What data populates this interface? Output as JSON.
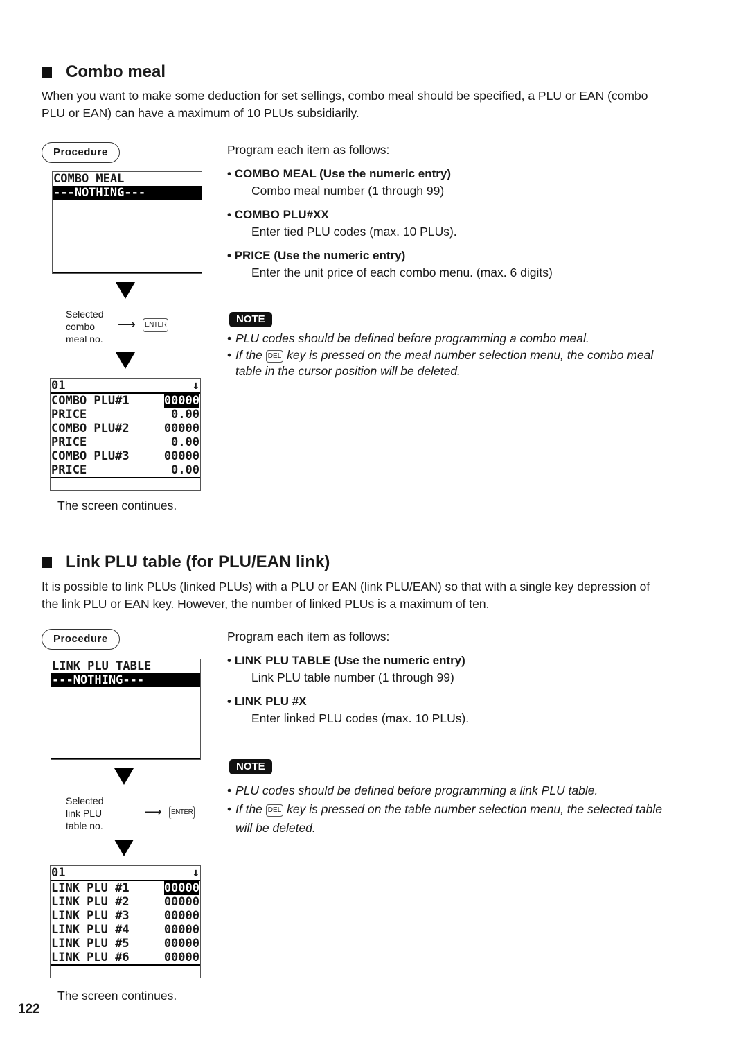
{
  "page_number": "122",
  "sections": [
    {
      "title": "Combo meal",
      "intro": "When you want to make some deduction for set sellings, combo meal should be specified, a PLU or EAN (combo PLU or EAN) can have a maximum of 10 PLUs subsidiarily.",
      "procedure_label": "Procedure",
      "screen1": {
        "title": "COMBO MEAL",
        "highlight": "---NOTHING---"
      },
      "selection": {
        "label_lines": [
          "Selected",
          "combo",
          "meal no."
        ],
        "key": "ENTER"
      },
      "screen2": {
        "header": "01",
        "scroll_indicator": "↓",
        "rows": [
          {
            "label": "COMBO PLU#1",
            "value": "00000"
          },
          {
            "label": "PRICE",
            "value": "0.00"
          },
          {
            "label": "COMBO PLU#2",
            "value": "00000"
          },
          {
            "label": "PRICE",
            "value": "0.00"
          },
          {
            "label": "COMBO PLU#3",
            "value": "00000"
          },
          {
            "label": "PRICE",
            "value": "0.00"
          }
        ]
      },
      "continues": "The screen continues.",
      "program_intro": "Program each item as follows:",
      "items": [
        {
          "heading": "COMBO MEAL (Use the numeric entry)",
          "desc": "Combo meal number (1 through 99)"
        },
        {
          "heading": "COMBO PLU#XX",
          "desc": "Enter tied PLU codes (max. 10 PLUs)."
        },
        {
          "heading": "PRICE (Use the numeric entry)",
          "desc": "Enter the unit price of each combo menu. (max. 6 digits)"
        }
      ],
      "note_label": "NOTE",
      "notes": {
        "n1": "PLU codes should be defined before programming a combo meal.",
        "n2_pre": "If the",
        "n2_key": "DEL",
        "n2_post": "key is pressed on the meal number selection menu, the combo meal table in the cursor position will be deleted."
      }
    },
    {
      "title": "Link PLU table (for PLU/EAN link)",
      "intro": "It is possible to link PLUs (linked PLUs) with a PLU or EAN (link PLU/EAN) so that with a single key depression of the link PLU or EAN key.  However, the number of linked PLUs is a maximum of ten.",
      "procedure_label": "Procedure",
      "screen1": {
        "title": "LINK PLU TABLE",
        "highlight": "---NOTHING---"
      },
      "selection": {
        "label_lines": [
          "Selected",
          "link PLU",
          "table no."
        ],
        "key": "ENTER"
      },
      "screen2": {
        "header": "01",
        "scroll_indicator": "↓",
        "rows": [
          {
            "label": "LINK PLU #1",
            "value": "00000"
          },
          {
            "label": "LINK PLU #2",
            "value": "00000"
          },
          {
            "label": "LINK PLU #3",
            "value": "00000"
          },
          {
            "label": "LINK PLU #4",
            "value": "00000"
          },
          {
            "label": "LINK PLU #5",
            "value": "00000"
          },
          {
            "label": "LINK PLU #6",
            "value": "00000"
          }
        ]
      },
      "continues": "The screen continues.",
      "program_intro": "Program each item as follows:",
      "items": [
        {
          "heading": "LINK PLU TABLE (Use the numeric entry)",
          "desc": "Link PLU table number (1 through 99)"
        },
        {
          "heading": "LINK PLU #X",
          "desc": "Enter linked PLU codes (max. 10 PLUs)."
        }
      ],
      "note_label": "NOTE",
      "notes": {
        "n1": "PLU codes should be defined before programming a link PLU table.",
        "n2_pre": "If the",
        "n2_key": "DEL",
        "n2_post": "key is pressed on the table number selection menu, the selected table will be deleted."
      }
    }
  ]
}
